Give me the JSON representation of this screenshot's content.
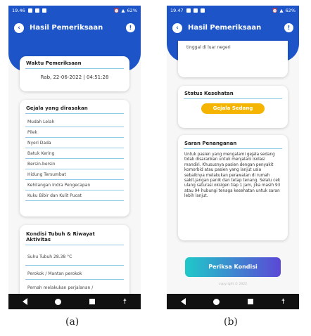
{
  "screen_a": {
    "status": {
      "time": "19.46",
      "battery": "62%"
    },
    "header": {
      "title": "Hasil Pemeriksaan"
    },
    "exam_time": {
      "label": "Waktu Pemeriksaan",
      "value": "Rab, 22-06-2022 | 04:51:28"
    },
    "symptoms": {
      "label": "Gejala yang dirasakan",
      "items": [
        "Mudah Lelah",
        "Pilek",
        "Nyeri Dada",
        "Batuk Kering",
        "Bersin-bersin",
        "Hidung Tersumbat",
        "Kehilangan Indra Pengecapan",
        "Kuku Bibir dan Kulit Pucat"
      ]
    },
    "condition": {
      "label": "Kondisi Tubuh & Riwayat Aktivitas",
      "items": [
        "Suhu Tubuh 28.38 °C",
        "Perokok / Mantan perokok",
        "Pernah melakukan perjalanan /"
      ]
    }
  },
  "screen_b": {
    "status": {
      "time": "19.47",
      "battery": "62%"
    },
    "header": {
      "title": "Hasil Pemeriksaan"
    },
    "travel_tail": "tinggal di luar negeri",
    "health_status": {
      "label": "Status Kesehatan",
      "value": "Gejala Sedang",
      "color": "#f5b400"
    },
    "advice": {
      "label": "Saran Penanganan",
      "text": "Untuk pasien yang mengalami gejala sedang tidak disarankan untuk menjalani isolasi mandiri. Khususnya pasien dengan penyakit komorbid atau pasien yang lanjut usia sebaiknya melakukan perawatan di rumah sakit.Jangan panik dan tetap tenang. Selalu cek ulang saturasi oksigen tiap 1 jam, jika masih 93 atau 94 hubungi tenaga kesehatan untuk saran lebih lanjut."
    },
    "check_button": "Periksa Kondisi",
    "copyright": "copyright © 2022"
  },
  "captions": {
    "a": "(a)",
    "b": "(b)"
  },
  "colors": {
    "primary": "#1d55c9",
    "accent_divider": "#8ecbe8",
    "button_gradient_start": "#1fc9c9",
    "button_gradient_end": "#5b48d6"
  }
}
